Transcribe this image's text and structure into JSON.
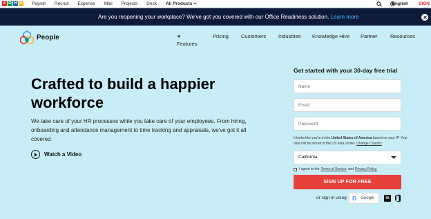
{
  "topbar": {
    "logo_letters": [
      "Z",
      "O",
      "H",
      "O"
    ],
    "logo_colors": [
      "#e42527",
      "#089949",
      "#226db4",
      "#f9b21d"
    ],
    "nav": [
      "Payroll",
      "Recruit",
      "Expense",
      "Mail",
      "Projects",
      "Desk",
      "All Products"
    ],
    "language": "English",
    "signin": "SIGN IN"
  },
  "announcement": {
    "text": "Are you reopening your workplace? We've got you covered with our Office Readiness solution.",
    "link": "Learn more"
  },
  "header": {
    "brand": "People",
    "nav": [
      "Features",
      "Pricing",
      "Customers",
      "Industries",
      "Knowledge Hive",
      "Partner",
      "Resources"
    ]
  },
  "hero": {
    "title": "Crafted to build a happier workforce",
    "description": "We take care of your HR processes while you take care of your employees. From hiring, onboarding and attendance management to time tracking and appraisals, we've got it all covered",
    "video": "Watch a Video"
  },
  "form": {
    "title": "Get started with your 30-day free trial",
    "name_placeholder": "Name",
    "email_placeholder": "Email",
    "password_placeholder": "Password",
    "note_prefix": "It looks like you're in the ",
    "note_country": "United States of America",
    "note_mid": " based on your IP. Your data will be stored in the US data center. ",
    "note_link": "Change Country",
    "state": "California",
    "agree_prefix": "I agree to the",
    "terms": "Terms of Service",
    "and": "and",
    "privacy": "Privacy Policy.",
    "signup": "SIGN UP FOR FREE",
    "signin_using": "or sign in using",
    "google": "Google",
    "google_mark": "G",
    "linkedin_mark": "in"
  },
  "colors": {
    "background": "#c9edf7",
    "announcement_bg": "#0e1a39",
    "signup_bg": "#e8413b",
    "accent_link": "#43b3ff"
  }
}
